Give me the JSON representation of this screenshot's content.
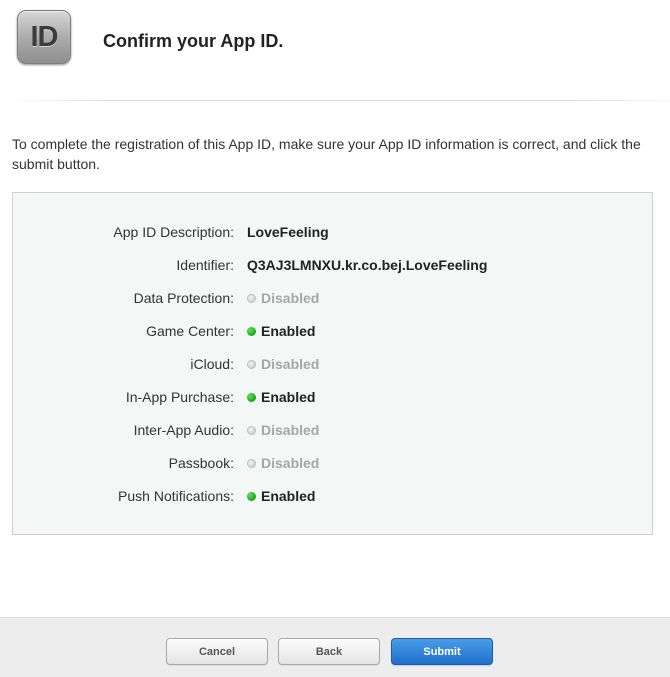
{
  "header": {
    "icon_text": "ID",
    "title": "Confirm your App ID."
  },
  "intro": "To complete the registration of this App ID, make sure your App ID information is correct, and click the submit button.",
  "summary": [
    {
      "label": "App ID Description:",
      "value": "LoveFeeling",
      "status": "text"
    },
    {
      "label": "Identifier:",
      "value": "Q3AJ3LMNXU.kr.co.bej.LoveFeeling",
      "status": "text"
    },
    {
      "label": "Data Protection:",
      "value": "Disabled",
      "status": "disabled"
    },
    {
      "label": "Game Center:",
      "value": "Enabled",
      "status": "enabled"
    },
    {
      "label": "iCloud:",
      "value": "Disabled",
      "status": "disabled"
    },
    {
      "label": "In-App Purchase:",
      "value": "Enabled",
      "status": "enabled"
    },
    {
      "label": "Inter-App Audio:",
      "value": "Disabled",
      "status": "disabled"
    },
    {
      "label": "Passbook:",
      "value": "Disabled",
      "status": "disabled"
    },
    {
      "label": "Push Notifications:",
      "value": "Enabled",
      "status": "enabled"
    }
  ],
  "footer": {
    "cancel_label": "Cancel",
    "back_label": "Back",
    "submit_label": "Submit"
  },
  "colors": {
    "enabled": "#1fae1c",
    "disabled": "#a6a6a6",
    "submit": "#1f6fcb"
  }
}
